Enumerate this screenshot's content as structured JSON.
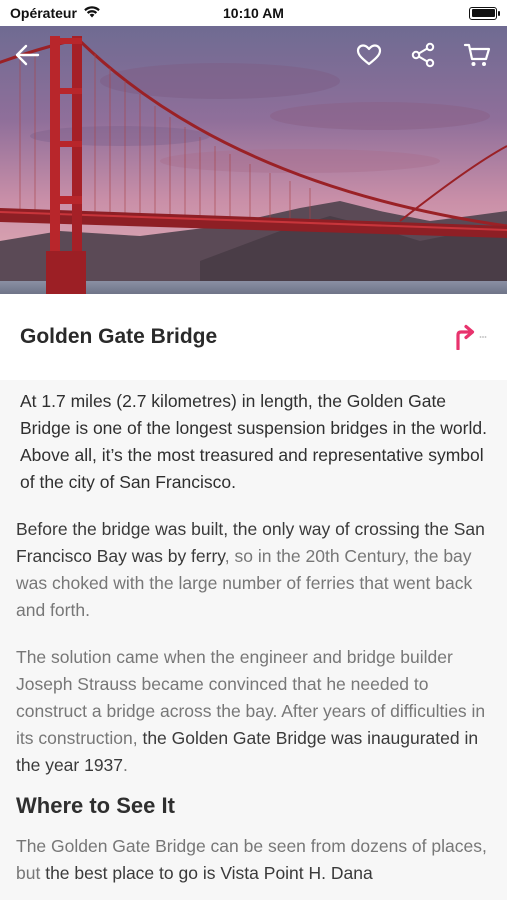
{
  "status_bar": {
    "carrier": "Opérateur",
    "time": "10:10 AM"
  },
  "header": {
    "title": "Golden Gate Bridge"
  },
  "icons": {
    "back": "arrow-left-icon",
    "favorite": "heart-icon",
    "share": "share-icon",
    "cart": "cart-icon",
    "directions": "turn-right-arrow-icon"
  },
  "colors": {
    "accent": "#e8336d",
    "bridge": "#b8262b"
  },
  "article": {
    "lead": "At 1.7 miles (2.7 kilometres) in length, the Golden Gate Bridge is one of the longest suspension bridges in the world. Above all, it’s the most treasured and representative symbol of the city of San Francisco.",
    "p1_bold": "Before the bridge was built, the only way of crossing the San Francisco Bay was by ferry",
    "p1_rest": ", so in the 20th Century, the bay was choked with the large number of ferries that went back and forth.",
    "p2_start": "The solution came when the engineer and bridge builder Joseph Strauss became convinced that he needed to construct a bridge across the bay. After years of difficulties in its construction, ",
    "p2_bold": "the Golden Gate Bridge was inaugurated in the year 1937",
    "p2_end": ".",
    "section_heading": "Where to See It",
    "p3_start": "The Golden Gate Bridge can be seen from dozens of places, but ",
    "p3_bold": "the best place to go is Vista Point H. Dana"
  }
}
